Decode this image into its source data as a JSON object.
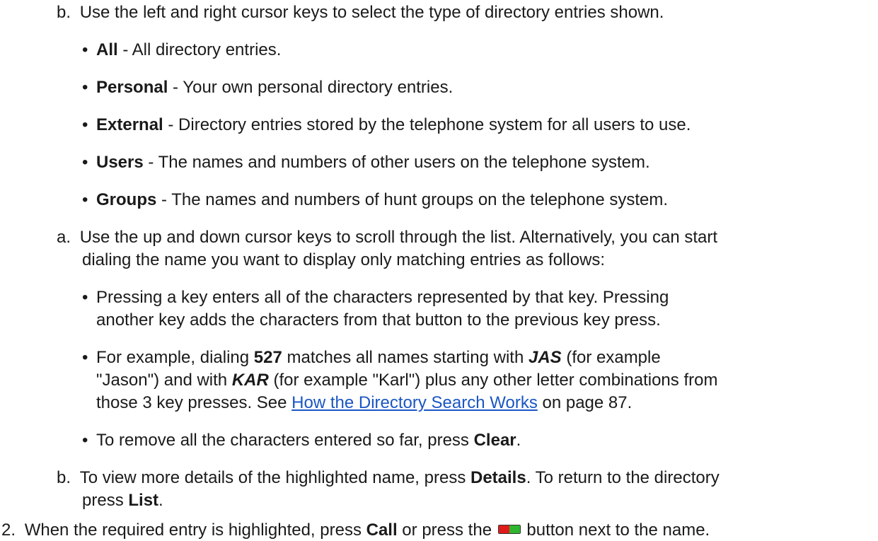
{
  "step_b1": {
    "marker": "b.",
    "text": "Use the left and right cursor keys to select the type of directory entries shown."
  },
  "entry_types": [
    {
      "term": "All",
      "desc": " - All directory entries."
    },
    {
      "term": "Personal",
      "desc": " - Your own personal directory entries."
    },
    {
      "term": "External",
      "desc": " - Directory entries stored by the telephone system for all users to use."
    },
    {
      "term": "Users",
      "desc": " - The names and numbers of other users on the telephone system."
    },
    {
      "term": "Groups",
      "desc": " - The names and numbers of hunt groups on the telephone system."
    }
  ],
  "step_a": {
    "marker": "a.",
    "line1": "Use the up and down cursor keys to scroll through the list. Alternatively, you can start",
    "line2": "dialing the name you want to display only matching entries as follows:"
  },
  "bullet_press": {
    "line1": "Pressing a key enters all of the characters represented by that key. Pressing",
    "line2": "another key adds the characters from that button to the previous key press."
  },
  "bullet_example": {
    "pre": "For example, dialing ",
    "digits": "527",
    "mid1": " matches all names starting with ",
    "jas": "JAS",
    "mid2": " (for example",
    "line2_a": "\"Jason\") and with ",
    "kar": "KAR",
    "line2_b": " (for example \"Karl\") plus any other letter combinations from",
    "line3_pre": "those 3 key presses. See ",
    "link": "How the Directory Search Works",
    "line3_post": " on page 87."
  },
  "bullet_clear": {
    "pre": "To remove all the characters entered so far, press ",
    "key": "Clear",
    "post": "."
  },
  "step_b2": {
    "marker": "b.",
    "pre": "To view more details of the highlighted name, press ",
    "key1": "Details",
    "mid": ". To return to the directory",
    "line2_pre": "press ",
    "key2": "List",
    "line2_post": "."
  },
  "step_2": {
    "marker": "2.",
    "pre": "When the required entry is highlighted, press ",
    "key": "Call",
    "mid": " or press the ",
    "post": " button next to the name.",
    "button_icon": "red-green-led-icon"
  },
  "colors": {
    "link": "#1a56c4",
    "led_red": "#e01b1b",
    "led_green": "#2fb52f"
  }
}
